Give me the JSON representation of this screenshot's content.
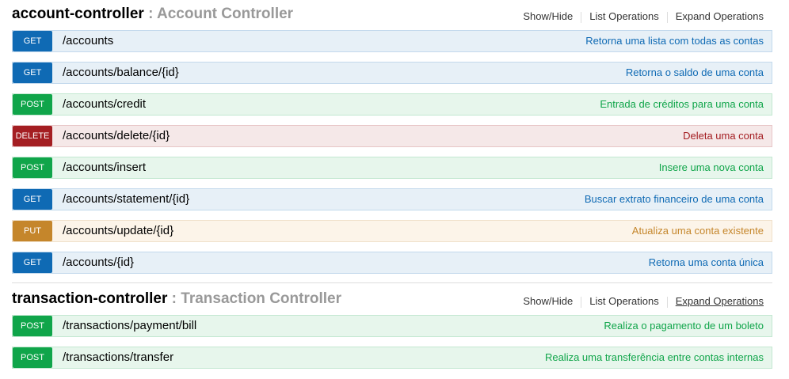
{
  "sections": [
    {
      "id": "account",
      "name": "account-controller",
      "sep": " : ",
      "desc": "Account Controller",
      "links": {
        "show_hide": "Show/Hide",
        "list": "List Operations",
        "expand": "Expand Operations"
      },
      "ops": [
        {
          "method": "GET",
          "kind": "get",
          "path": "/accounts",
          "summary": "Retorna uma lista com todas as contas"
        },
        {
          "method": "GET",
          "kind": "get",
          "path": "/accounts/balance/{id}",
          "summary": "Retorna o saldo de uma conta"
        },
        {
          "method": "POST",
          "kind": "post",
          "path": "/accounts/credit",
          "summary": "Entrada de créditos para uma conta"
        },
        {
          "method": "DELETE",
          "kind": "delete",
          "path": "/accounts/delete/{id}",
          "summary": "Deleta uma conta"
        },
        {
          "method": "POST",
          "kind": "post",
          "path": "/accounts/insert",
          "summary": "Insere uma nova conta"
        },
        {
          "method": "GET",
          "kind": "get",
          "path": "/accounts/statement/{id}",
          "summary": "Buscar extrato financeiro de uma conta"
        },
        {
          "method": "PUT",
          "kind": "put",
          "path": "/accounts/update/{id}",
          "summary": "Atualiza uma conta existente"
        },
        {
          "method": "GET",
          "kind": "get",
          "path": "/accounts/{id}",
          "summary": "Retorna uma conta única"
        }
      ]
    },
    {
      "id": "transaction",
      "name": "transaction-controller",
      "sep": " : ",
      "desc": "Transaction Controller",
      "links": {
        "show_hide": "Show/Hide",
        "list": "List Operations",
        "expand": "Expand Operations"
      },
      "ops": [
        {
          "method": "POST",
          "kind": "post",
          "path": "/transactions/payment/bill",
          "summary": "Realiza o pagamento de um boleto"
        },
        {
          "method": "POST",
          "kind": "post",
          "path": "/transactions/transfer",
          "summary": "Realiza uma transferência entre contas internas"
        }
      ]
    }
  ],
  "colors": {
    "get": "#0f6ab4",
    "post": "#10a54a",
    "delete": "#a41e22",
    "put": "#c5862b"
  }
}
